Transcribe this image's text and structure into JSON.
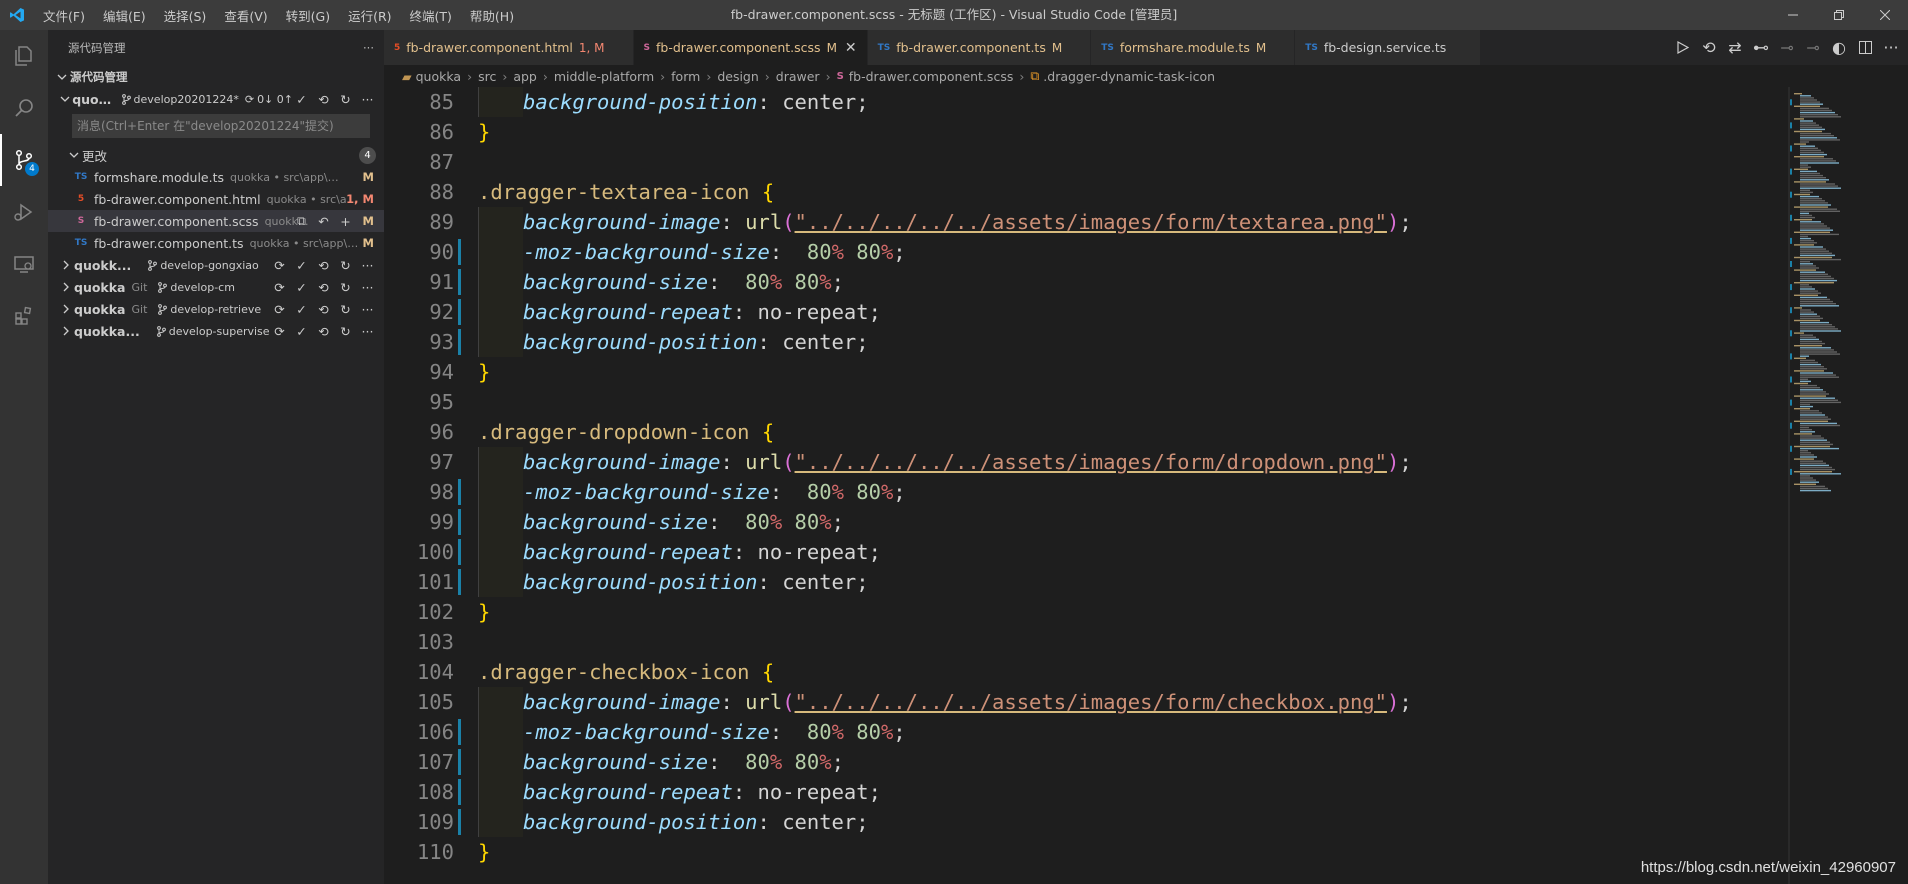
{
  "window": {
    "title": "fb-drawer.component.scss - 无标题 (工作区) - Visual Studio Code [管理员]",
    "menu": [
      "文件(F)",
      "编辑(E)",
      "选择(S)",
      "查看(V)",
      "转到(G)",
      "运行(R)",
      "终端(T)",
      "帮助(H)"
    ]
  },
  "activity": {
    "scm_badge": "4"
  },
  "sidebar": {
    "header": "源代码管理",
    "section_title": "源代码管理",
    "main_repo": {
      "name": "quokk...",
      "branch": "develop20201224*",
      "sync": "0↓ 0↑"
    },
    "commit_placeholder": "消息(Ctrl+Enter 在\"develop20201224\"提交)",
    "changes_label": "更改",
    "changes_count": "4",
    "files": [
      {
        "icon": "TS",
        "name": "formshare.module.ts",
        "path": "quokka • src\\app\\middl...",
        "status": "M"
      },
      {
        "icon": "5",
        "name": "fb-drawer.component.html",
        "path": "quokka • src\\a...",
        "status": "1, M"
      },
      {
        "icon": "S",
        "name": "fb-drawer.component.scss",
        "path": "quokk...",
        "status": "M"
      },
      {
        "icon": "TS",
        "name": "fb-drawer.component.ts",
        "path": "quokka • src\\app\\mi...",
        "status": "M"
      }
    ],
    "other_repos": [
      {
        "name": "quokk...",
        "provider": "",
        "branch": "develop-gongxiao"
      },
      {
        "name": "quokka",
        "provider": "Git",
        "branch": "develop-cm"
      },
      {
        "name": "quokka",
        "provider": "Git",
        "branch": "develop-retrieve"
      },
      {
        "name": "quokka...",
        "provider": "",
        "branch": "develop-supervise"
      }
    ]
  },
  "tabs": [
    {
      "icon": "5",
      "label": "fb-drawer.component.html",
      "mark": "1, M",
      "active": false
    },
    {
      "icon": "S",
      "label": "fb-drawer.component.scss",
      "mark": "M",
      "active": true
    },
    {
      "icon": "TS",
      "label": "fb-drawer.component.ts",
      "mark": "M",
      "active": false
    },
    {
      "icon": "TS",
      "label": "formshare.module.ts",
      "mark": "M",
      "active": false
    },
    {
      "icon": "TS",
      "label": "fb-design.service.ts",
      "mark": "",
      "active": false
    }
  ],
  "breadcrumb": [
    "quokka",
    "src",
    "app",
    "middle-platform",
    "form",
    "design",
    "drawer",
    "fb-drawer.component.scss",
    ".dragger-dynamic-task-icon"
  ],
  "code": {
    "lines": [
      {
        "n": "85",
        "kind": "decl",
        "prop": "background-position",
        "value": "center",
        "mark": false
      },
      {
        "n": "86",
        "kind": "close",
        "mark": false
      },
      {
        "n": "87",
        "kind": "blank",
        "mark": false
      },
      {
        "n": "88",
        "kind": "open",
        "selector": ".dragger-textarea-icon",
        "mark": false
      },
      {
        "n": "89",
        "kind": "url",
        "prop": "background-image",
        "fn": "url",
        "str": "\"../../../../../assets/images/form/textarea.png\"",
        "mark": false
      },
      {
        "n": "90",
        "kind": "size",
        "prop": "-moz-background-size",
        "n1": "80",
        "n2": "80",
        "mark": true
      },
      {
        "n": "91",
        "kind": "size",
        "prop": "background-size",
        "n1": "80",
        "n2": "80",
        "mark": true
      },
      {
        "n": "92",
        "kind": "decl",
        "prop": "background-repeat",
        "value": "no-repeat",
        "mark": true
      },
      {
        "n": "93",
        "kind": "decl",
        "prop": "background-position",
        "value": "center",
        "mark": true
      },
      {
        "n": "94",
        "kind": "close",
        "mark": false
      },
      {
        "n": "95",
        "kind": "blank",
        "mark": false
      },
      {
        "n": "96",
        "kind": "open",
        "selector": ".dragger-dropdown-icon",
        "mark": false
      },
      {
        "n": "97",
        "kind": "url",
        "prop": "background-image",
        "fn": "url",
        "str": "\"../../../../../assets/images/form/dropdown.png\"",
        "mark": false
      },
      {
        "n": "98",
        "kind": "size",
        "prop": "-moz-background-size",
        "n1": "80",
        "n2": "80",
        "mark": true
      },
      {
        "n": "99",
        "kind": "size",
        "prop": "background-size",
        "n1": "80",
        "n2": "80",
        "mark": true
      },
      {
        "n": "100",
        "kind": "decl",
        "prop": "background-repeat",
        "value": "no-repeat",
        "mark": true
      },
      {
        "n": "101",
        "kind": "decl",
        "prop": "background-position",
        "value": "center",
        "mark": true
      },
      {
        "n": "102",
        "kind": "close",
        "mark": false
      },
      {
        "n": "103",
        "kind": "blank",
        "mark": false
      },
      {
        "n": "104",
        "kind": "open",
        "selector": ".dragger-checkbox-icon",
        "mark": false
      },
      {
        "n": "105",
        "kind": "url",
        "prop": "background-image",
        "fn": "url",
        "str": "\"../../../../../assets/images/form/checkbox.png\"",
        "mark": false
      },
      {
        "n": "106",
        "kind": "size",
        "prop": "-moz-background-size",
        "n1": "80",
        "n2": "80",
        "mark": true
      },
      {
        "n": "107",
        "kind": "size",
        "prop": "background-size",
        "n1": "80",
        "n2": "80",
        "mark": true
      },
      {
        "n": "108",
        "kind": "decl",
        "prop": "background-repeat",
        "value": "no-repeat",
        "mark": true
      },
      {
        "n": "109",
        "kind": "decl",
        "prop": "background-position",
        "value": "center",
        "mark": true
      },
      {
        "n": "110",
        "kind": "close",
        "mark": false
      }
    ]
  },
  "watermark": "https://blog.csdn.net/weixin_42960907",
  "colors": {
    "accent": "#007acc",
    "modified": "#e2c08d",
    "error_count": "#f48771"
  }
}
